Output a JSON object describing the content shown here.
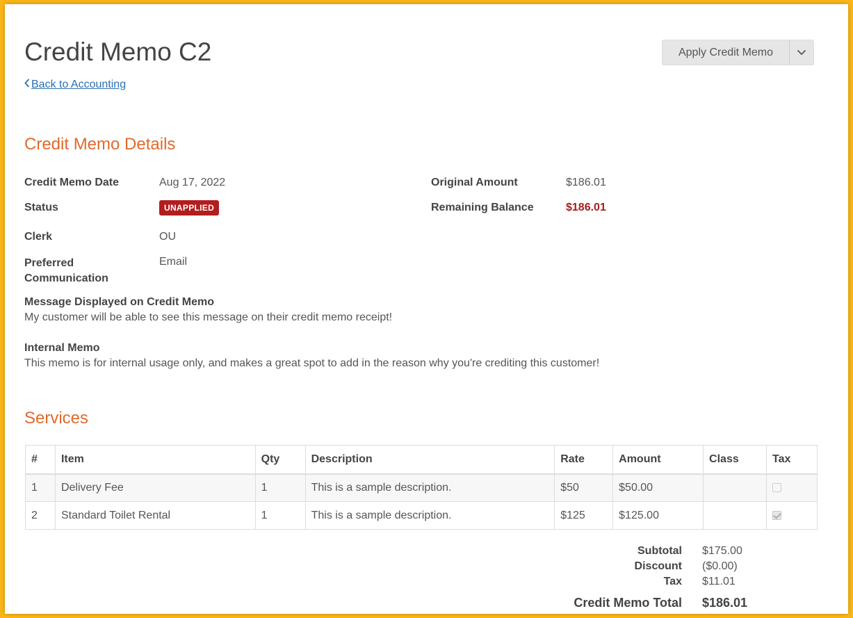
{
  "header": {
    "title": "Credit Memo C2",
    "back_link": "Back to Accounting",
    "apply_button": "Apply Credit Memo"
  },
  "details": {
    "section_title": "Credit Memo Details",
    "credit_memo_date_label": "Credit Memo Date",
    "credit_memo_date": "Aug 17, 2022",
    "status_label": "Status",
    "status": "UNAPPLIED",
    "clerk_label": "Clerk",
    "clerk": "OU",
    "preferred_label_line1": "Preferred",
    "preferred_label_line2": "Communication",
    "preferred": "Email",
    "original_amount_label": "Original Amount",
    "original_amount": "$186.01",
    "remaining_balance_label": "Remaining Balance",
    "remaining_balance": "$186.01",
    "message_label": "Message Displayed on Credit Memo",
    "message": "My customer will be able to see this message on their credit memo receipt!",
    "internal_memo_label": "Internal Memo",
    "internal_memo": "This memo is for internal usage only, and makes a great spot to add in the reason why you're crediting this customer!"
  },
  "services": {
    "section_title": "Services",
    "columns": [
      "#",
      "Item",
      "Qty",
      "Description",
      "Rate",
      "Amount",
      "Class",
      "Tax"
    ],
    "rows": [
      {
        "num": "1",
        "item": "Delivery Fee",
        "qty": "1",
        "description": "This is a sample description.",
        "rate": "$50",
        "amount": "$50.00",
        "class": "",
        "tax": false
      },
      {
        "num": "2",
        "item": "Standard Toilet Rental",
        "qty": "1",
        "description": "This is a sample description.",
        "rate": "$125",
        "amount": "$125.00",
        "class": "",
        "tax": true
      }
    ]
  },
  "totals": {
    "subtotal_label": "Subtotal",
    "subtotal": "$175.00",
    "discount_label": "Discount",
    "discount": "($0.00)",
    "tax_label": "Tax",
    "tax": "$11.01",
    "total_label": "Credit Memo Total",
    "total": "$186.01"
  },
  "colors": {
    "accent": "#e2692c",
    "status_badge": "#b21e1e",
    "link": "#2c6fae",
    "frame": "#fbb718"
  }
}
